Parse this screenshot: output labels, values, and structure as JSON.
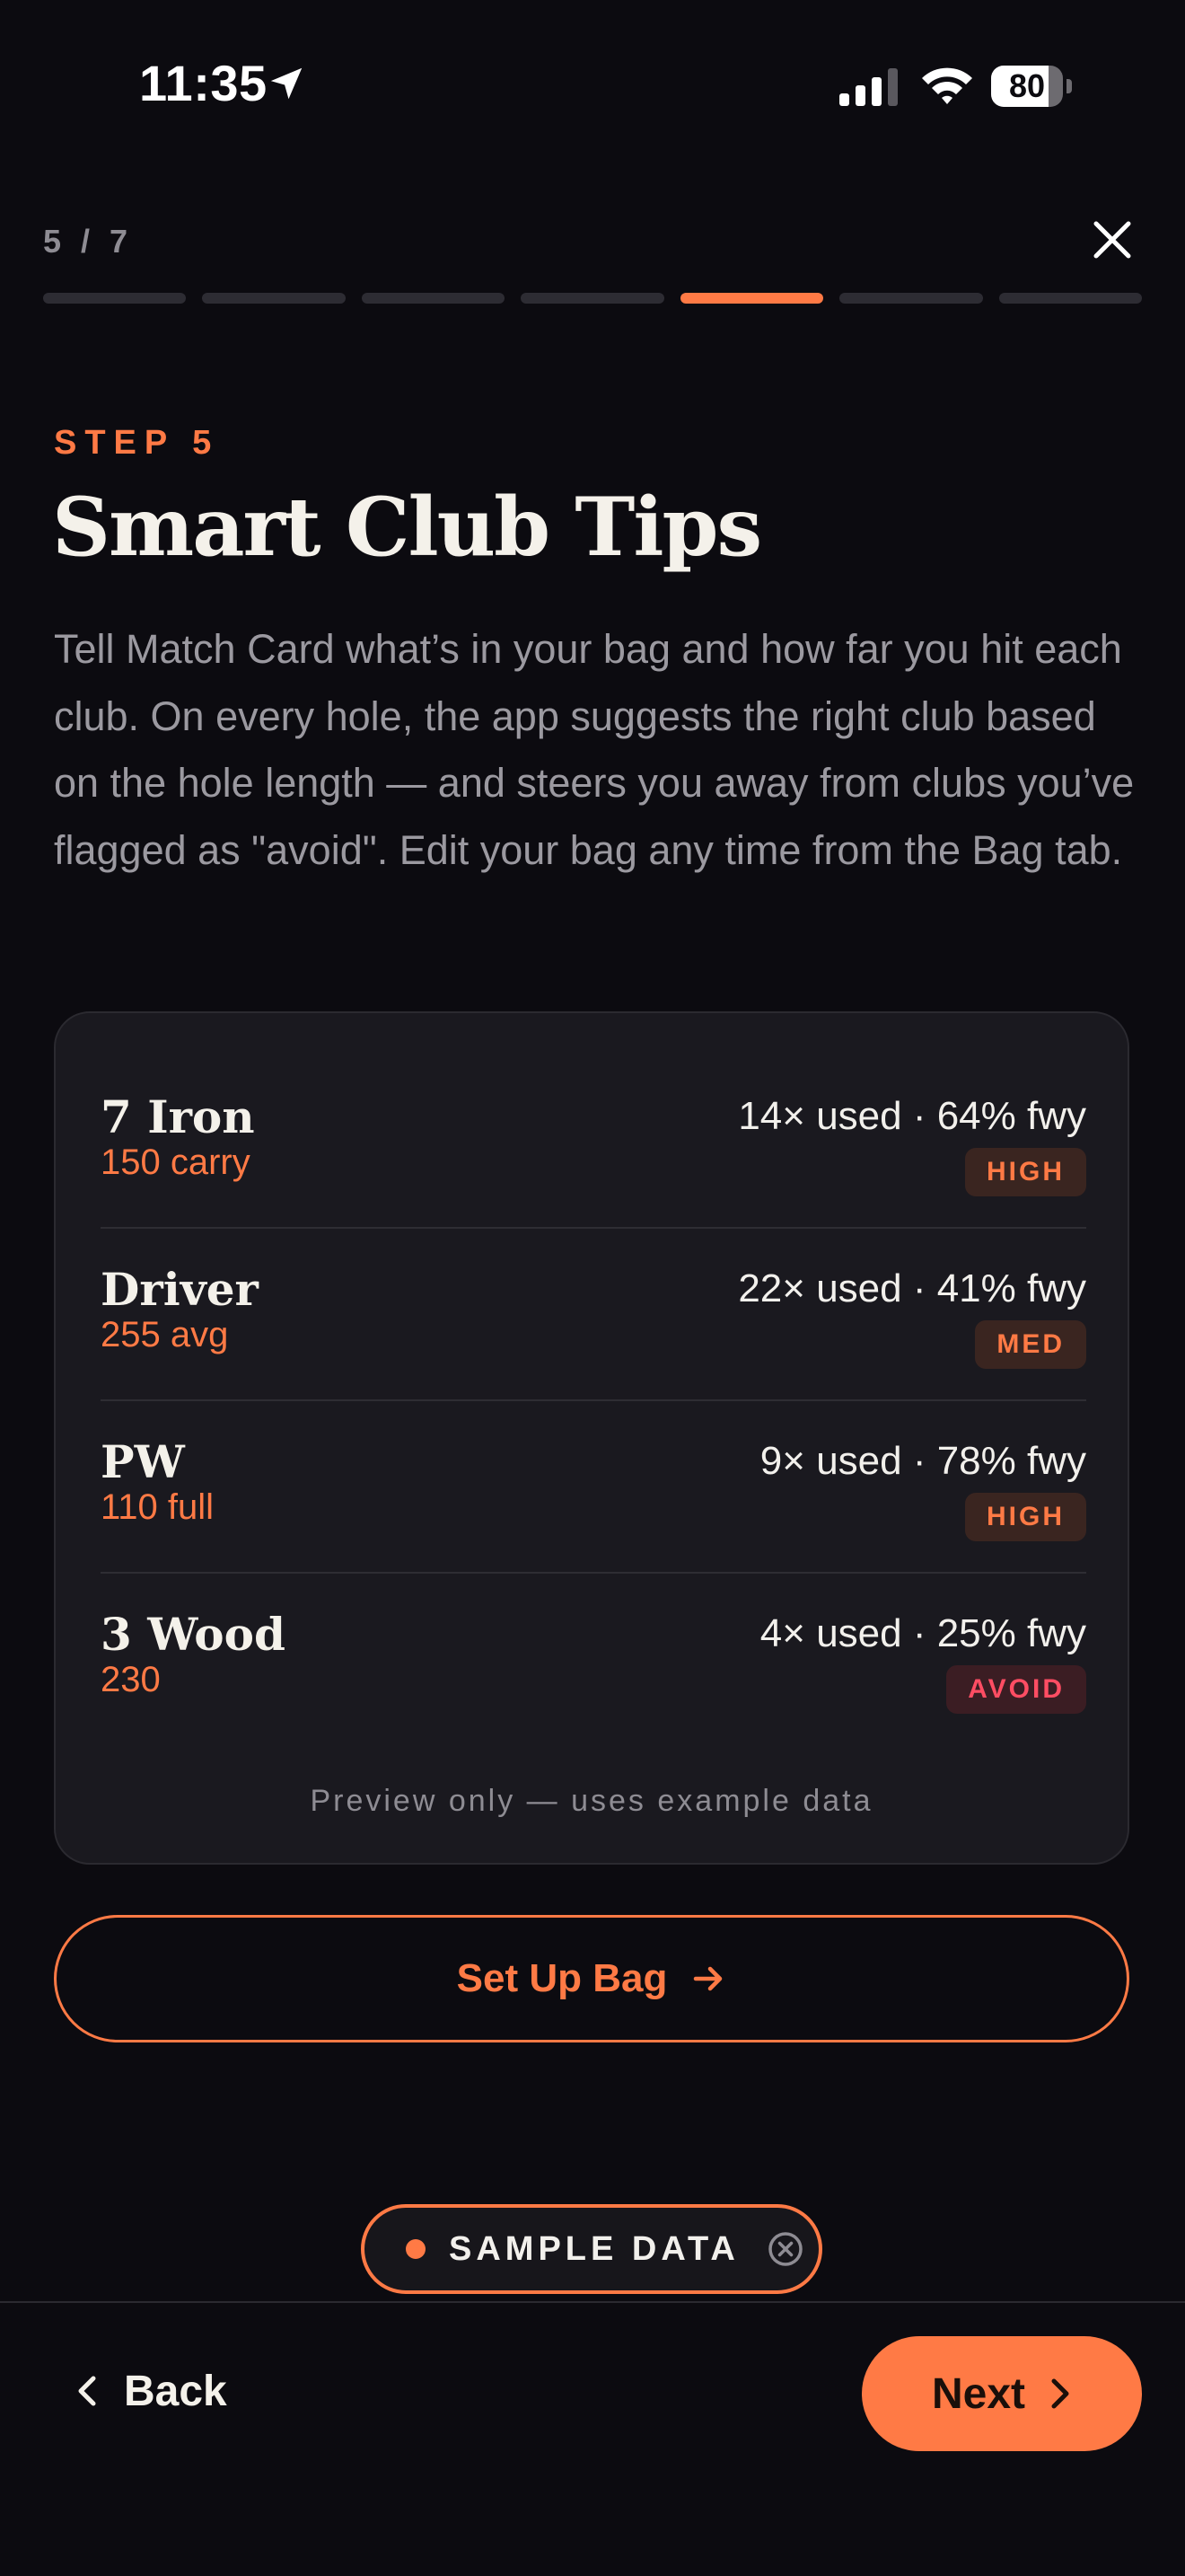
{
  "status_bar": {
    "time": "11:35",
    "battery_percent": "80",
    "battery_level": 0.8
  },
  "progress": {
    "counter": "5 / 7",
    "current_step": 5,
    "total_steps": 7
  },
  "header": {
    "step_label": "STEP 5",
    "title": "Smart Club Tips",
    "description": "Tell Match Card what’s in your bag and how far you hit each club. On every hole, the app suggests the right club based on the hole length — and steers you away from clubs you’ve flagged as \"avoid\". Edit your bag any time from the Bag tab."
  },
  "preview_card": {
    "clubs": [
      {
        "name": "7 Iron",
        "distance": "150 carry",
        "stats": "14× used · 64% fwy",
        "badge": "HIGH",
        "badge_tone": "good"
      },
      {
        "name": "Driver",
        "distance": "255 avg",
        "stats": "22× used · 41% fwy",
        "badge": "MED",
        "badge_tone": "good"
      },
      {
        "name": "PW",
        "distance": "110 full",
        "stats": "9× used · 78% fwy",
        "badge": "HIGH",
        "badge_tone": "good"
      },
      {
        "name": "3 Wood",
        "distance": "230",
        "stats": "4× used · 25% fwy",
        "badge": "AVOID",
        "badge_tone": "bad"
      }
    ],
    "footnote": "Preview only — uses example data"
  },
  "actions": {
    "setup_bag_label": "Set Up Bag",
    "sample_data_label": "SAMPLE DATA",
    "back_label": "Back",
    "next_label": "Next"
  },
  "colors": {
    "accent": "#ff7a45",
    "background": "#0c0b10",
    "card": "#1a191f",
    "avoid": "#ff4d63"
  },
  "icons": {
    "location": "location-arrow-icon",
    "signal": "cellular-signal-icon",
    "wifi": "wifi-icon",
    "close": "close-icon",
    "arrow_right": "arrow-right-icon",
    "dismiss": "circle-x-icon",
    "back": "chevron-left-icon",
    "next": "chevron-right-icon"
  }
}
